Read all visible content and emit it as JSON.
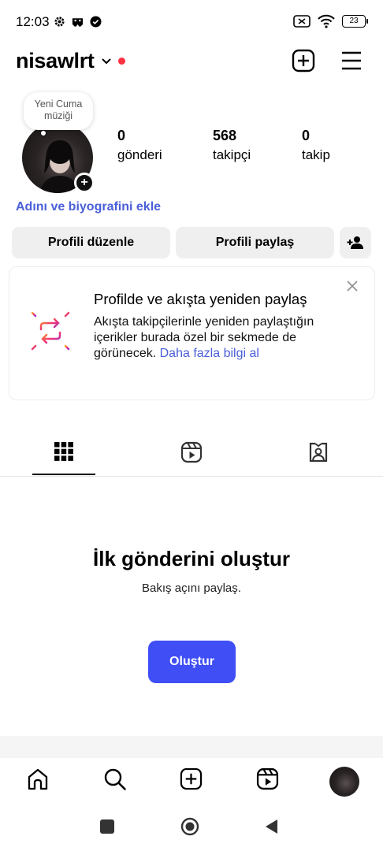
{
  "status_bar": {
    "time": "12:03",
    "battery": "23"
  },
  "header": {
    "username": "nisawlrt"
  },
  "profile": {
    "note": "Yeni Cuma müziği",
    "stats": [
      {
        "value": "0",
        "label": "gönderi"
      },
      {
        "value": "568",
        "label": "takipçi"
      },
      {
        "value": "0",
        "label": "takip"
      }
    ],
    "bio_link": "Adını ve biyografini ekle"
  },
  "buttons": {
    "edit_profile": "Profili düzenle",
    "share_profile": "Profili paylaş"
  },
  "card": {
    "title": "Profilde ve akışta yeniden paylaş",
    "body": "Akışta takipçilerinle yeniden paylaştığın içerikler burada özel bir sekmede de görünecek.",
    "more_link": "Daha fazla bilgi al"
  },
  "tabs": [
    {
      "icon": "grid-icon",
      "active": true
    },
    {
      "icon": "reels-icon",
      "active": false
    },
    {
      "icon": "tagged-icon",
      "active": false
    }
  ],
  "empty_state": {
    "title": "İlk gönderini oluştur",
    "subtitle": "Bakış açını paylaş.",
    "button": "Oluştur"
  },
  "bottom_nav": [
    {
      "icon": "home-icon"
    },
    {
      "icon": "search-icon"
    },
    {
      "icon": "create-icon"
    },
    {
      "icon": "reels-icon"
    },
    {
      "icon": "profile-avatar"
    }
  ],
  "colors": {
    "accent_blue": "#3f4ef5",
    "link_blue": "#4a5fd8",
    "notification_red": "#ff3040",
    "button_gray": "#efefef"
  }
}
